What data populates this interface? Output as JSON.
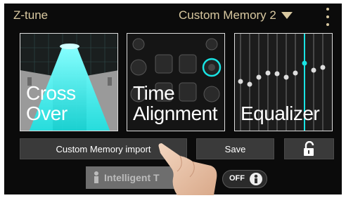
{
  "header": {
    "app_title": "Z-tune",
    "preset_label": "Custom Memory 2",
    "menu_icon": "vertical-ellipsis-icon"
  },
  "tiles": {
    "crossover": "Cross\nOver",
    "time_alignment": "Time\nAlignment",
    "equalizer": "Equalizer"
  },
  "buttons": {
    "import": "Custom Memory import",
    "save": "Save",
    "lock_icon": "unlock-icon"
  },
  "intelligent": {
    "label": "Intelligent T",
    "toggle_text": "OFF"
  },
  "colors": {
    "accent_cyan": "#19e3e3",
    "header_text": "#d8c8a0"
  }
}
